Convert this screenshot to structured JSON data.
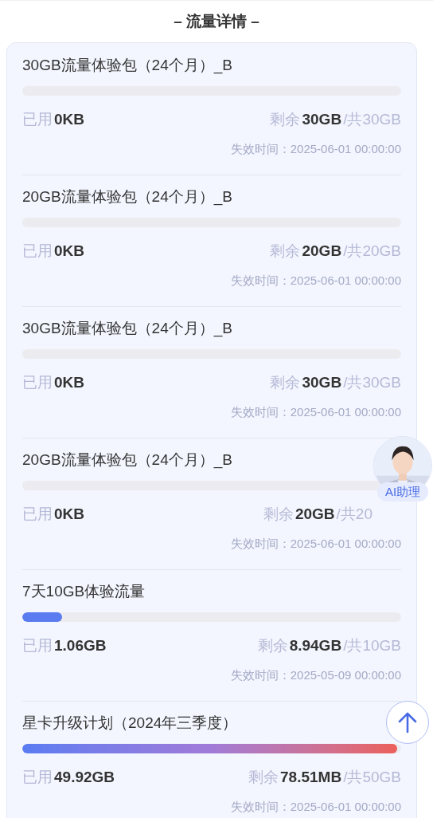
{
  "header": {
    "title": "– 流量详情 –"
  },
  "packages": [
    {
      "name": "30GB流量体验包（24个月）_B",
      "kind": "solid",
      "used_label": "已用",
      "used": "0KB",
      "remain_label": "剩余",
      "remain": "30GB",
      "total_label": "/共",
      "total": "30GB",
      "expiry": "失效时间：2025-06-01 00:00:00",
      "covered": false
    },
    {
      "name": "20GB流量体验包（24个月）_B",
      "kind": "solid",
      "used_label": "已用",
      "used": "0KB",
      "remain_label": "剩余",
      "remain": "20GB",
      "total_label": "/共",
      "total": "20GB",
      "expiry": "失效时间：2025-06-01 00:00:00",
      "covered": false
    },
    {
      "name": "30GB流量体验包（24个月）_B",
      "kind": "solid",
      "used_label": "已用",
      "used": "0KB",
      "remain_label": "剩余",
      "remain": "30GB",
      "total_label": "/共",
      "total": "30GB",
      "expiry": "失效时间：2025-06-01 00:00:00",
      "covered": false
    },
    {
      "name": "20GB流量体验包（24个月）_B",
      "kind": "solid",
      "used_label": "已用",
      "used": "0KB",
      "remain_label": "剩余",
      "remain": "20GB",
      "total_label": "/共",
      "total": "20",
      "expiry": "失效时间：2025-06-01 00:00:00",
      "covered": true
    },
    {
      "name": "7天10GB体验流量",
      "kind": "solid",
      "level": 0.106,
      "used_label": "已用",
      "used": "1.06GB",
      "remain_label": "剩余",
      "remain": "8.94GB",
      "total_label": "/共",
      "total": "10GB",
      "expiry": "失效时间：2025-05-09 00:00:00",
      "covered": false
    },
    {
      "name": "星卡升级计划（2024年三季度）",
      "kind": "gradient",
      "level": 0.99,
      "used_label": "已用",
      "used": "49.92GB",
      "remain_label": "剩余",
      "remain": "78.51MB",
      "total_label": "/共",
      "total": "50GB",
      "expiry": "失效时间：2025-06-01 00:00:00",
      "covered": false
    }
  ],
  "assistant": {
    "label": "AI助理"
  }
}
